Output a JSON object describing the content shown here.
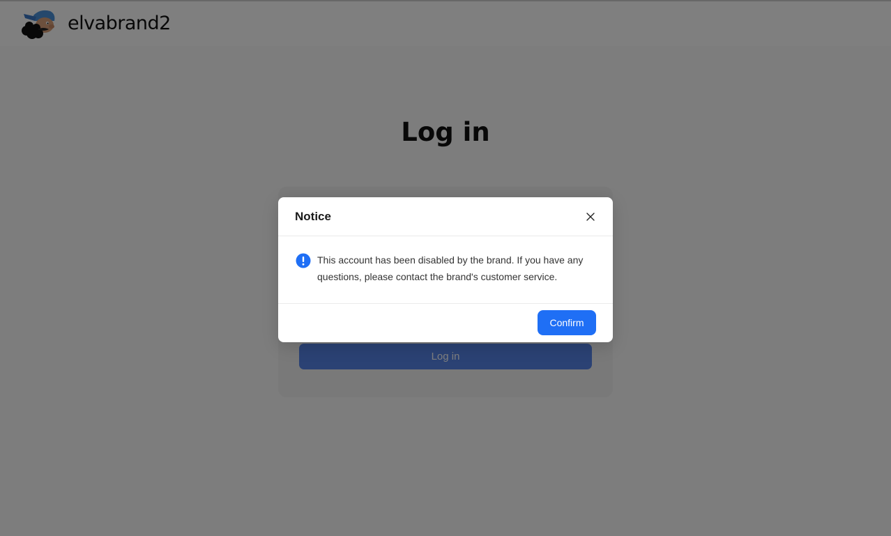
{
  "header": {
    "brand_name": "elvabrand2"
  },
  "page": {
    "title": "Log in",
    "login_button_label": "Log in"
  },
  "modal": {
    "title": "Notice",
    "message": "This account has been disabled by the brand. If you have any questions, please contact the brand's customer service.",
    "confirm_label": "Confirm"
  },
  "colors": {
    "primary": "#1f6ff5",
    "overlay": "rgba(0,0,0,0.5)",
    "info_icon": "#1f6ff5"
  },
  "icons": {
    "logo": "cartoon-mascot-logo",
    "close": "close-icon",
    "info": "info-icon"
  }
}
